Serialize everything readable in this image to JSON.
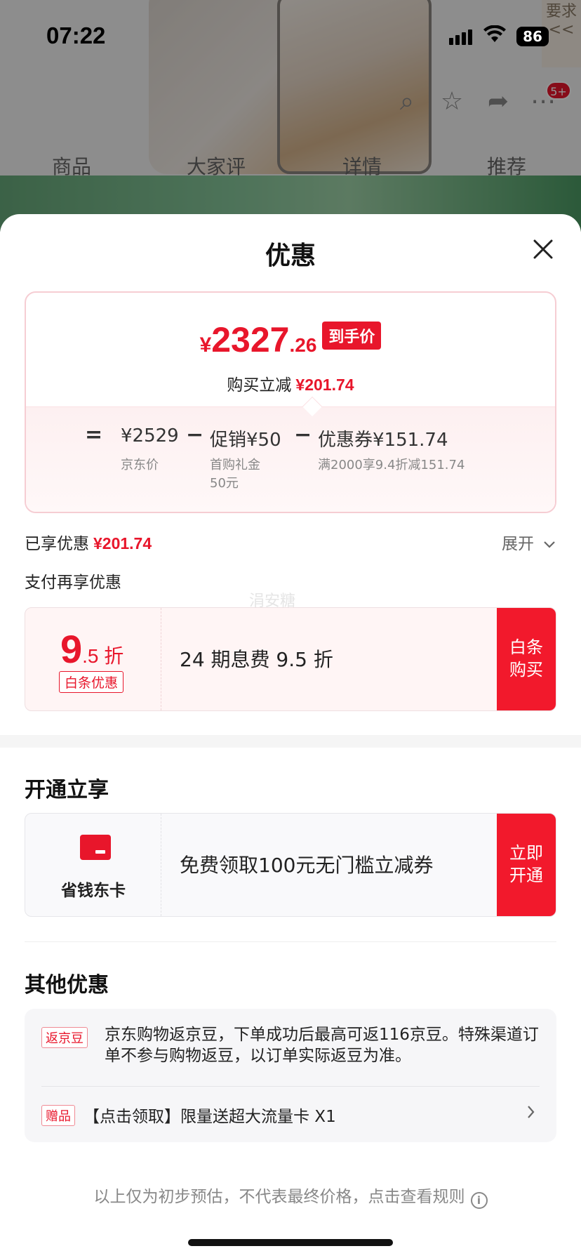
{
  "status_bar": {
    "time": "07:22",
    "battery": "86"
  },
  "background": {
    "tabs": [
      "商品",
      "大家评",
      "详情",
      "推荐"
    ],
    "cart_badge": "5+",
    "side_text": "要求<<"
  },
  "sheet": {
    "title": "优惠",
    "final_price": {
      "yen": "¥",
      "integer": "2327",
      "decimal": ".26",
      "tag": "到手价"
    },
    "reduce": {
      "label": "购买立减",
      "amount": "¥201.74"
    },
    "calc": {
      "eq": "=",
      "base": {
        "value": "¥2529",
        "label": "京东价"
      },
      "op1": "−",
      "promo": {
        "value": "促销¥50",
        "label1": "首购礼金",
        "label2": "50元"
      },
      "op2": "−",
      "coupon": {
        "value": "优惠券¥151.74",
        "label": "满2000享9.4折减151.74"
      }
    },
    "enjoyed": {
      "label": "已享优惠",
      "amount": "¥201.74",
      "expand": "展开"
    },
    "pay_title": "支付再享优惠",
    "watermark": "涓安糖",
    "baitiao": {
      "discount_big": "9",
      "discount_small": ".5 折",
      "tag": "白条优惠",
      "desc": "24 期息费 9.5 折",
      "button": [
        "白条",
        "购买"
      ]
    },
    "open_section": {
      "title": "开通立享",
      "card_label": "省钱东卡",
      "desc": "免费领取100元无门槛立减券",
      "button": [
        "立即",
        "开通"
      ]
    },
    "other_section": {
      "title": "其他优惠",
      "bean_tag": "返京豆",
      "bean_text": "京东购物返京豆，下单成功后最高可返116京豆。特殊渠道订单不参与购物返豆，以订单实际返豆为准。",
      "gift_tag": "赠品",
      "gift_text": "【点击领取】限量送超大流量卡 X1"
    },
    "footer": "以上仅为初步预估，不代表最终价格，点击查看规则",
    "info_icon": "i"
  },
  "colors": {
    "accent": "#e8162b",
    "button": "#f2192c"
  }
}
